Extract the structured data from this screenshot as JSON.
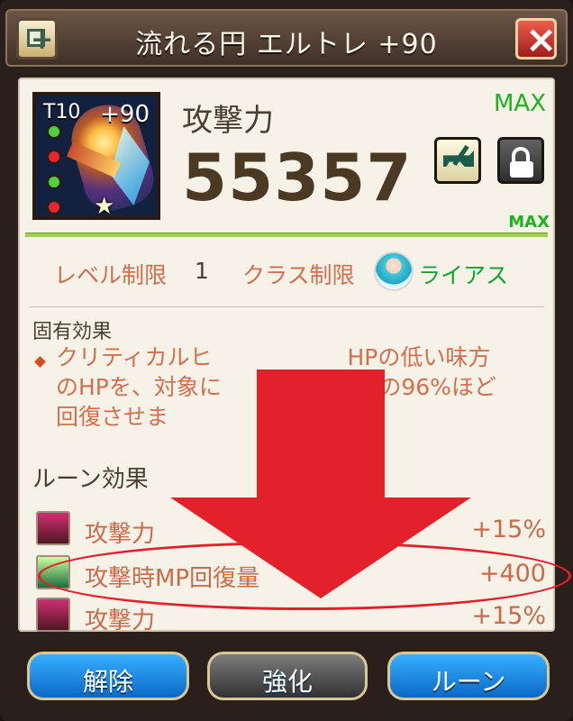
{
  "dialog": {
    "title": "流れる円 エルトレ +90"
  },
  "icons": {
    "expand": "expand-icon",
    "close": "close-icon",
    "enhance": "anvil-icon",
    "lock": "unlock-icon",
    "class": "character-avatar-icon"
  },
  "weapon": {
    "tier": "T10",
    "plus": "+90"
  },
  "stat": {
    "label": "攻撃力",
    "max": "MAX",
    "value": "55357",
    "max_small": "MAX"
  },
  "limits": {
    "level_label": "レベル制限",
    "level_value": "1",
    "class_label": "クラス制限",
    "class_name": "ライアス"
  },
  "unique": {
    "title": "固有効果",
    "text": "クリティカルヒ　　　　　　HPの低い味方\nのHPを、対象に　　　　　ージの96%ほど\n回復させま"
  },
  "runes": {
    "title": "ルーン効果",
    "items": [
      {
        "name": "攻撃力",
        "value": "+15%"
      },
      {
        "name": "攻撃時MP回復量",
        "value": "+400"
      },
      {
        "name": "攻撃力",
        "value": "+15%"
      }
    ]
  },
  "buttons": {
    "release": "解除",
    "enhance": "強化",
    "rune": "ルーン"
  },
  "colors": {
    "accent_red": "#e3212b",
    "max_green": "#1db21f",
    "text_orange": "#d16e4f"
  }
}
